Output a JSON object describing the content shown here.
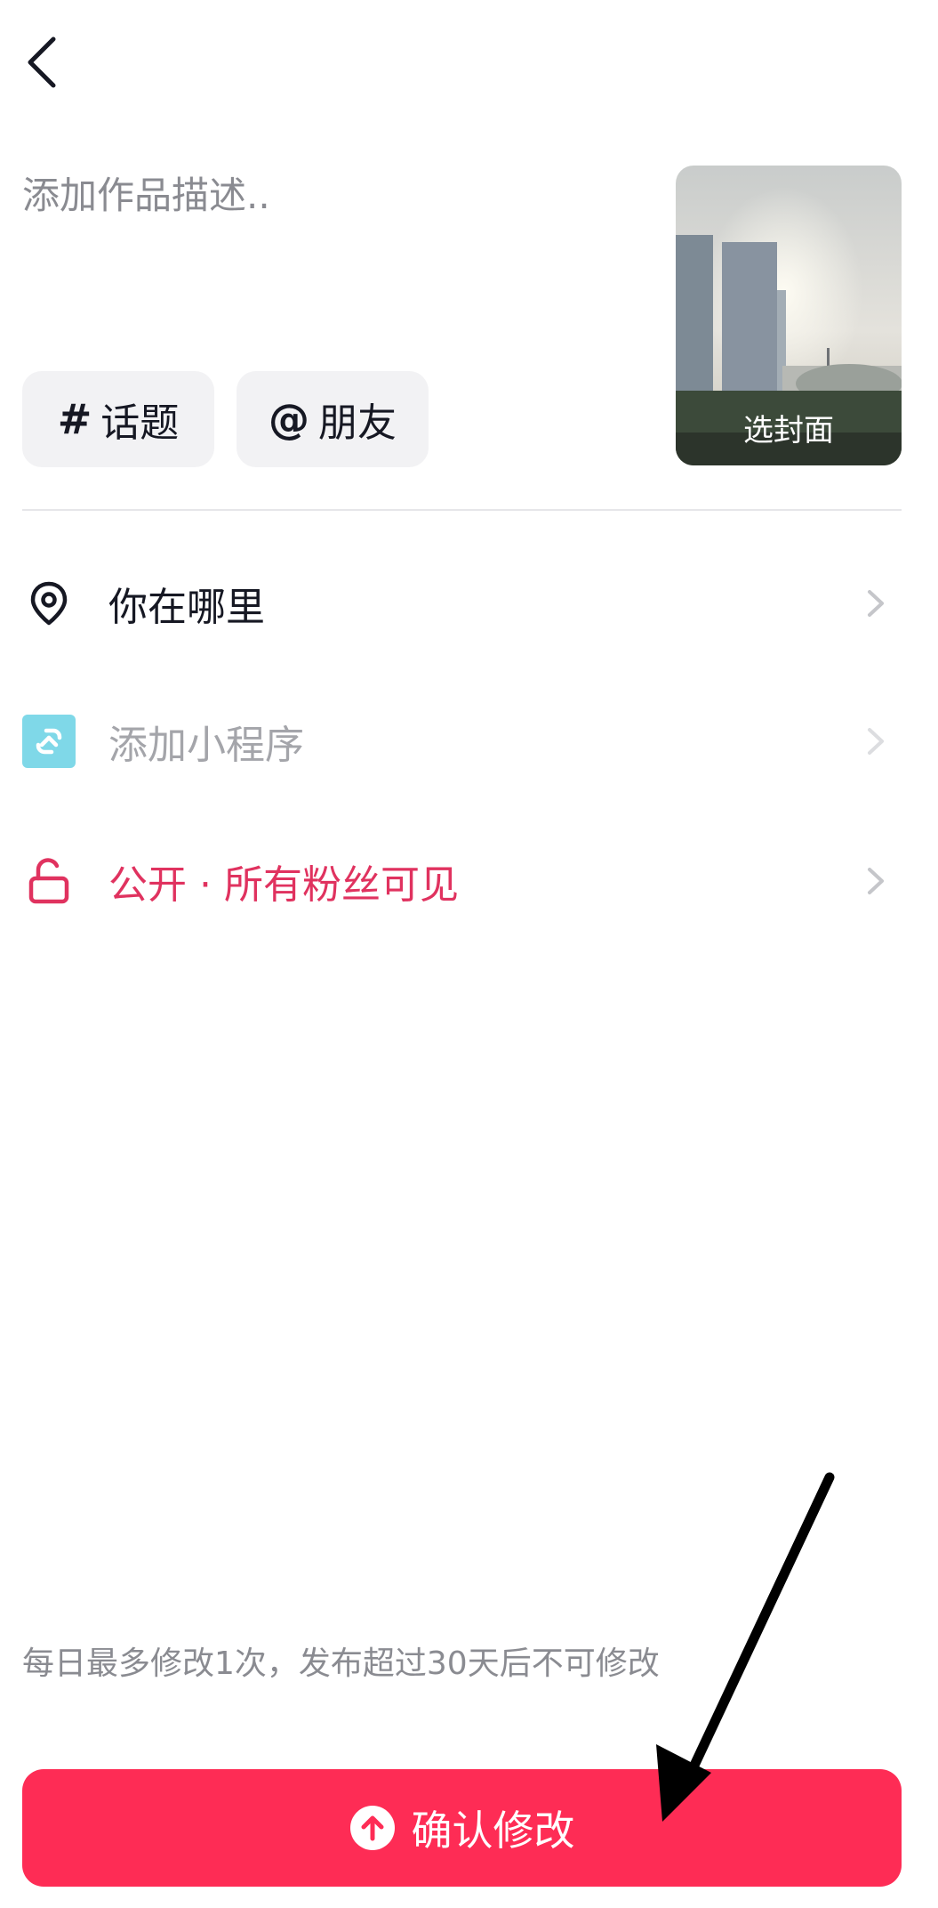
{
  "header": {
    "back_icon": "chevron-left-icon"
  },
  "description": {
    "placeholder": "添加作品描述.."
  },
  "chips": {
    "topic": {
      "symbol": "#",
      "label": "话题"
    },
    "friend": {
      "symbol": "@",
      "label": "朋友"
    }
  },
  "cover": {
    "label": "选封面"
  },
  "options": {
    "location": {
      "icon": "location-pin-icon",
      "label": "你在哪里"
    },
    "mini_program": {
      "icon": "mini-program-icon",
      "label": "添加小程序"
    },
    "privacy": {
      "icon": "unlock-icon",
      "label": "公开 · 所有粉丝可见"
    }
  },
  "note": "每日最多修改1次，发布超过30天后不可修改",
  "confirm": {
    "icon": "upload-arrow-icon",
    "label": "确认修改"
  },
  "colors": {
    "accent": "#fe2c55",
    "privacy_text": "#e0325f",
    "mini_program_icon_bg": "#7fd8e8",
    "chip_bg": "#f2f2f4",
    "placeholder_text": "#8a8b91"
  }
}
